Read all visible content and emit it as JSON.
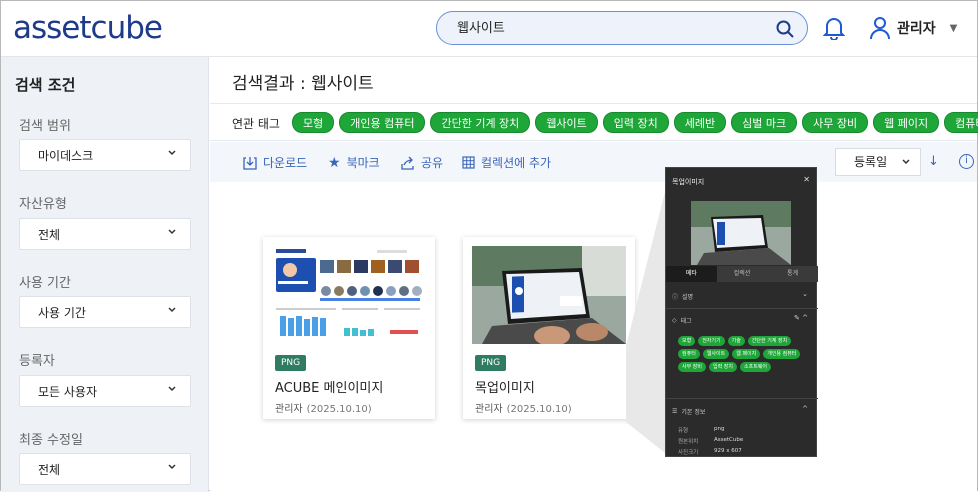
{
  "header": {
    "logo": "assetcube",
    "search_value": "웹사이트",
    "user_name": "관리자"
  },
  "sidebar": {
    "title": "검색 조건",
    "filters": [
      {
        "label": "검색 범위",
        "value": "마이데스크"
      },
      {
        "label": "자산유형",
        "value": "전체"
      },
      {
        "label": "사용 기간",
        "value": "사용 기간"
      },
      {
        "label": "등록자",
        "value": "모든 사용자"
      },
      {
        "label": "최종 수정일",
        "value": "전체"
      }
    ]
  },
  "main": {
    "results_title": "검색결과 : 웹사이트",
    "related_label": "연관 태그",
    "related_tags": [
      "모형",
      "개인용 컴퓨터",
      "간단한 기계 장치",
      "웹사이트",
      "입력 장치",
      "세례반",
      "심벌 마크",
      "사무 장비",
      "웹 페이지",
      "컴퓨터"
    ],
    "toolbar": {
      "download": "다운로드",
      "bookmark": "북마크",
      "share": "공유",
      "add_collection": "컬렉션에 추가",
      "sort_value": "등록일"
    },
    "cards": [
      {
        "badge": "PNG",
        "title": "ACUBE 메인이미지",
        "owner": "관리자",
        "date": "(2025.10.10)"
      },
      {
        "badge": "PNG",
        "title": "목업이미지",
        "owner": "관리자",
        "date": "(2025.10.10)"
      }
    ]
  },
  "panel": {
    "title": "목업이미지",
    "tabs": [
      "메타",
      "컬렉션",
      "통계"
    ],
    "section_desc": "설명",
    "section_tags": "태그",
    "tags": [
      "모형",
      "전자기기",
      "기술",
      "간단한 기계 장치",
      "컴퓨터",
      "웹사이트",
      "웹 페이지",
      "개인용 컴퓨터",
      "사무 장비",
      "입력 장치",
      "소프트웨어"
    ],
    "section_info": "기본 정보",
    "info_rows": [
      {
        "k": "유형",
        "v": "png"
      },
      {
        "k": "원본위치",
        "v": "AssetCube"
      },
      {
        "k": "사진크기",
        "v": "929 x 607"
      }
    ]
  },
  "colors": {
    "accent": "#3a66b8",
    "tag_green": "#1fa638",
    "badge": "#2f7c63",
    "logo": "#1e3a8a"
  }
}
